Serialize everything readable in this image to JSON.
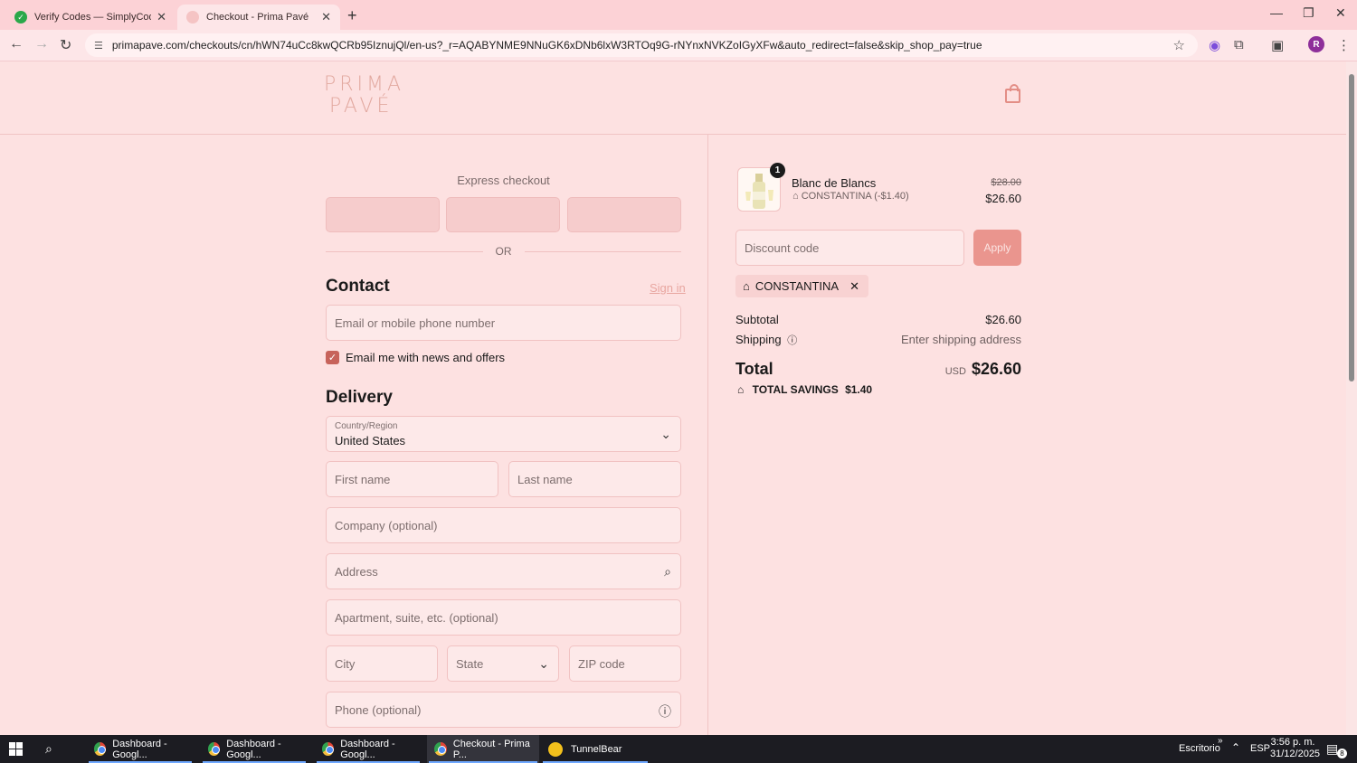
{
  "browser": {
    "tabs": [
      {
        "title": "Verify Codes — SimplyCodes",
        "active": false
      },
      {
        "title": "Checkout - Prima Pavé",
        "active": true
      }
    ],
    "url": "primapave.com/checkouts/cn/hWN74uCc8kwQCRb95IznujQl/en-us?_r=AQABYNME9NNuGK6xDNb6lxW3RTOq9G-rNYnxNVKZoIGyXFw&auto_redirect=false&skip_shop_pay=true",
    "profile_initial": "R"
  },
  "header": {
    "logo_line1": "PRIMA",
    "logo_line2": "PAVÉ"
  },
  "checkout": {
    "express_title": "Express checkout",
    "or_label": "OR",
    "contact": {
      "heading": "Contact",
      "sign_in": "Sign in",
      "email_placeholder": "Email or mobile phone number",
      "newsletter_label": "Email me with news and offers",
      "newsletter_checked": true
    },
    "delivery": {
      "heading": "Delivery",
      "country_label": "Country/Region",
      "country_value": "United States",
      "first_name": "First name",
      "last_name": "Last name",
      "company": "Company (optional)",
      "address": "Address",
      "apartment": "Apartment, suite, etc. (optional)",
      "city": "City",
      "state": "State",
      "zip": "ZIP code",
      "phone": "Phone (optional)"
    }
  },
  "summary": {
    "product": {
      "quantity": "1",
      "name": "Blanc de Blancs",
      "discount": "CONSTANTINA (-$1.40)",
      "original_price": "$28.00",
      "price": "$26.60"
    },
    "discount_placeholder": "Discount code",
    "apply_label": "Apply",
    "applied_code": "CONSTANTINA",
    "subtotal_label": "Subtotal",
    "subtotal_value": "$26.60",
    "shipping_label": "Shipping",
    "shipping_value": "Enter shipping address",
    "total_label": "Total",
    "total_currency": "USD",
    "total_value": "$26.60",
    "savings_label": "TOTAL SAVINGS",
    "savings_value": "$1.40"
  },
  "taskbar": {
    "items": [
      "Dashboard - Googl...",
      "Dashboard - Googl...",
      "Dashboard - Googl...",
      "Checkout - Prima P...",
      "TunnelBear"
    ],
    "desktop_label": "Escritorio",
    "language": "ESP",
    "time": "3:56 p. m.",
    "date": "31/12/2025",
    "notification_count": "8"
  },
  "colors": {
    "background": "#fde1e1",
    "accent": "#ea958e",
    "checkbox": "#c7635b"
  }
}
